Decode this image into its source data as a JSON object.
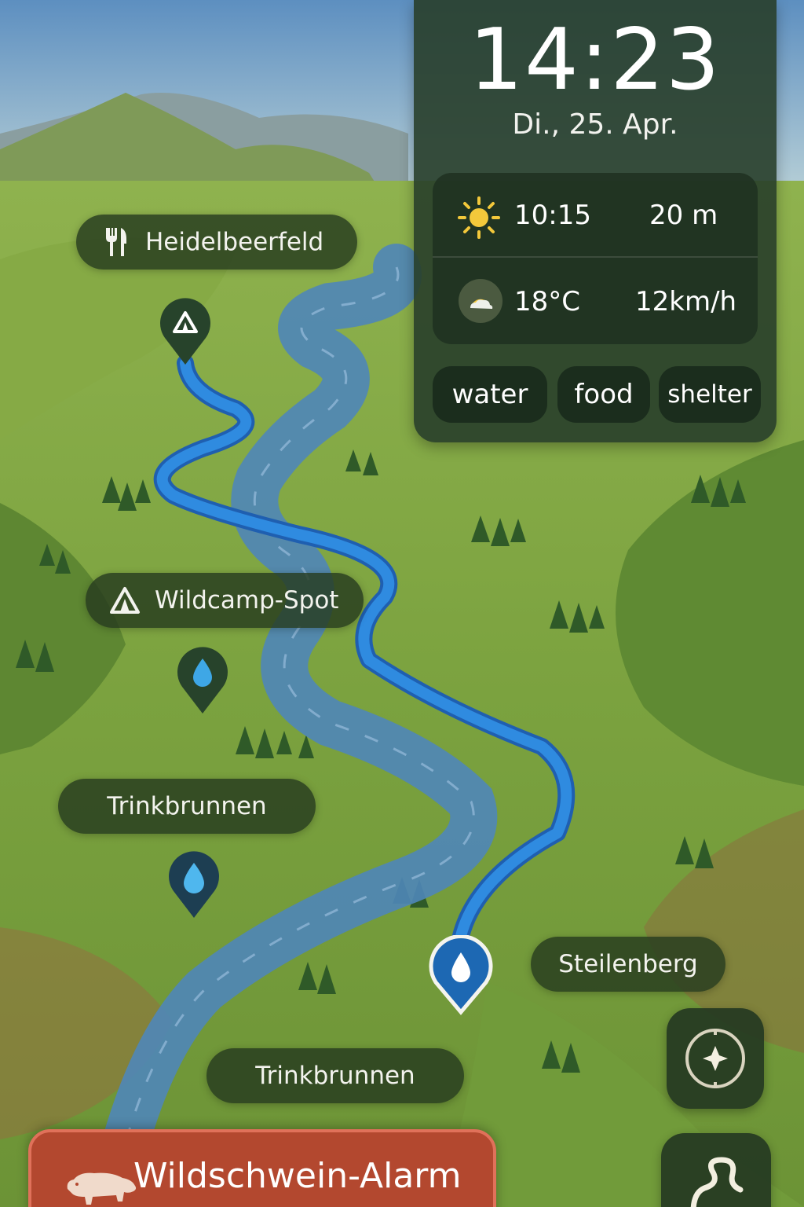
{
  "map": {
    "pins": [
      {
        "label": "Heidelbeerfeld",
        "icon": "fork-knife-icon"
      },
      {
        "label": "Wildcamp-Spot",
        "icon": "tent-icon"
      },
      {
        "label": "Trinkbrunnen",
        "icon": ""
      },
      {
        "label": "Steilenberg",
        "icon": ""
      },
      {
        "label": "Trinkbrunnen",
        "icon": ""
      }
    ],
    "markers": [
      "tent-icon",
      "water-drop-icon",
      "water-drop-icon",
      "water-drop-icon"
    ]
  },
  "widget": {
    "time": "14:23",
    "date": "Di., 25. Apr.",
    "sunrise": "10:15",
    "distance": "20 m",
    "temperature": "18°C",
    "wind": "12km/h",
    "filters": [
      "water",
      "food",
      "shelter"
    ]
  },
  "controls": {
    "compass": "compass-icon",
    "route": "route-icon"
  },
  "alert": {
    "title": "Wildschwein-Alarm",
    "icon": "boar-icon"
  },
  "colors": {
    "route": "#2f8be0",
    "alert": "#b3482f",
    "panel": "#283e2a"
  }
}
